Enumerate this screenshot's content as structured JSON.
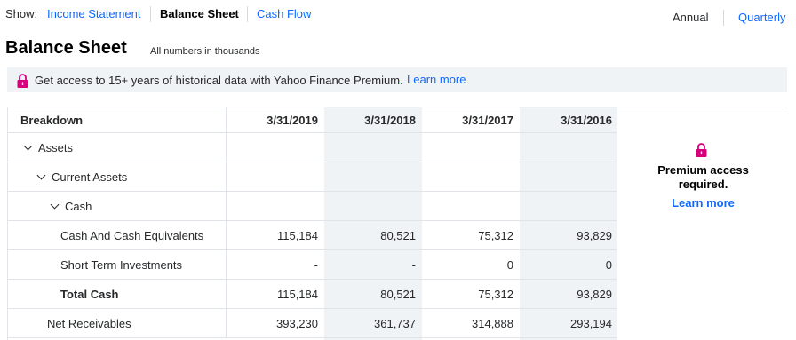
{
  "nav": {
    "show_label": "Show:",
    "tabs": [
      {
        "label": "Income Statement",
        "active": false
      },
      {
        "label": "Balance Sheet",
        "active": true
      },
      {
        "label": "Cash Flow",
        "active": false
      }
    ],
    "periods": [
      {
        "label": "Annual",
        "active": true
      },
      {
        "label": "Quarterly",
        "active": false
      }
    ]
  },
  "page": {
    "title": "Balance Sheet",
    "subtitle": "All numbers in thousands"
  },
  "promo": {
    "text": "Get access to 15+ years of historical data with Yahoo Finance Premium.",
    "link": "Learn more",
    "icon": "lock-icon"
  },
  "table": {
    "header_label": "Breakdown",
    "columns": [
      "3/31/2019",
      "3/31/2018",
      "3/31/2017",
      "3/31/2016"
    ],
    "rows": [
      {
        "label": "Assets",
        "expandable": true,
        "level": 0,
        "bold": false,
        "values": [
          "",
          "",
          "",
          ""
        ]
      },
      {
        "label": "Current Assets",
        "expandable": true,
        "level": 1,
        "bold": false,
        "values": [
          "",
          "",
          "",
          ""
        ]
      },
      {
        "label": "Cash",
        "expandable": true,
        "level": 2,
        "bold": false,
        "values": [
          "",
          "",
          "",
          ""
        ]
      },
      {
        "label": "Cash And Cash Equivalents",
        "expandable": false,
        "level": 3,
        "bold": false,
        "values": [
          "115,184",
          "80,521",
          "75,312",
          "93,829"
        ]
      },
      {
        "label": "Short Term Investments",
        "expandable": false,
        "level": 3,
        "bold": false,
        "values": [
          "-",
          "-",
          "0",
          "0"
        ]
      },
      {
        "label": "Total Cash",
        "expandable": false,
        "level": 3,
        "bold": true,
        "values": [
          "115,184",
          "80,521",
          "75,312",
          "93,829"
        ]
      },
      {
        "label": "Net Receivables",
        "expandable": false,
        "level": 2,
        "bold": false,
        "values": [
          "393,230",
          "361,737",
          "314,888",
          "293,194"
        ]
      }
    ]
  },
  "premium": {
    "icon": "lock-icon",
    "text": "Premium access required.",
    "link": "Learn more"
  },
  "colors": {
    "link": "#0f69ff",
    "lock": "#d6007b",
    "shade": "#f0f3f5",
    "border": "#e0e4e9"
  }
}
